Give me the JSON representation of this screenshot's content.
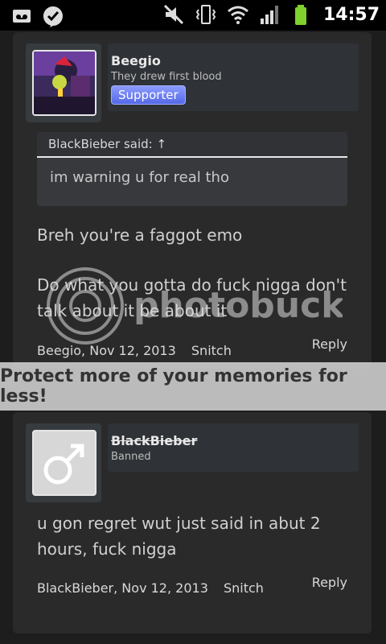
{
  "status_bar": {
    "time": "14:57",
    "left_icons": [
      "voicemail-icon",
      "check-badge-icon"
    ],
    "right_icons": [
      "mute-icon",
      "vibrate-icon",
      "wifi-icon",
      "signal-icon",
      "battery-icon"
    ]
  },
  "posts": [
    {
      "username": "Beegio",
      "user_title": "They drew first blood",
      "badge": "Supporter",
      "quote": {
        "header": "BlackBieber said: ↑",
        "body": "im warning u for real tho"
      },
      "message_lines": [
        "Breh you're a faggot emo",
        "Do what you gotta do fuck nigga don't talk about it be about it"
      ],
      "meta_author_date": "Beegio, Nov 12, 2013",
      "meta_action": "Snitch",
      "reply_label": "Reply"
    },
    {
      "username": "BlackBieber",
      "user_title": "Banned",
      "message_lines": [
        "u gon regret wut just said in abut 2 hours, fuck nigga"
      ],
      "meta_author_date": "BlackBieber, Nov 12, 2013",
      "meta_action": "Snitch",
      "reply_label": "Reply"
    }
  ],
  "watermark": {
    "logo_text": "photobucket",
    "banner_text": "Protect more of your memories for less!"
  }
}
